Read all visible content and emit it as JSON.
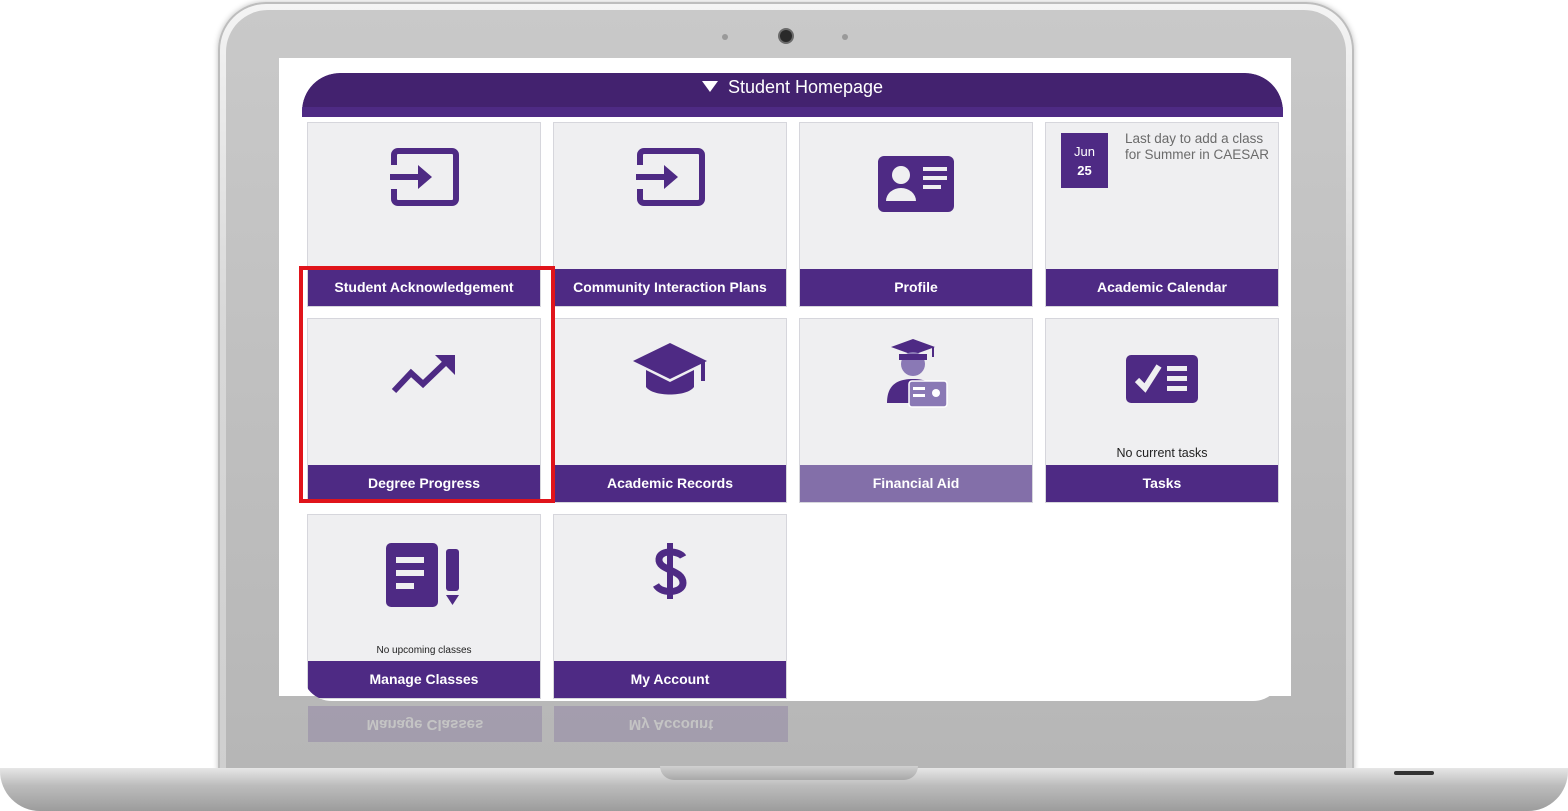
{
  "header": {
    "title": "Student Homepage"
  },
  "tiles": {
    "student_ack": {
      "label": "Student Acknowledgement"
    },
    "community": {
      "label": "Community Interaction Plans"
    },
    "profile": {
      "label": "Profile"
    },
    "calendar": {
      "label": "Academic Calendar",
      "month": "Jun",
      "day": "25",
      "event": "Last day to add a class for Summer in CAESAR"
    },
    "degree": {
      "label": "Degree Progress"
    },
    "records": {
      "label": "Academic Records"
    },
    "finaid": {
      "label": "Financial Aid"
    },
    "tasks": {
      "label": "Tasks",
      "note": "No current tasks"
    },
    "manage": {
      "label": "Manage Classes",
      "note": "No upcoming classes"
    },
    "account": {
      "label": "My Account"
    }
  },
  "colors": {
    "brand_purple": "#4e2a84",
    "header_purple": "#43226f",
    "tile_bg": "#efeff1",
    "faded_purple": "#836fa9",
    "highlight_red": "#e0141b"
  },
  "icons": [
    "sign-in-icon",
    "sign-in-icon",
    "id-card-icon",
    "trending-up-icon",
    "graduation-cap-icon",
    "graduate-student-icon",
    "checklist-icon",
    "notepad-pencil-icon",
    "dollar-icon"
  ]
}
